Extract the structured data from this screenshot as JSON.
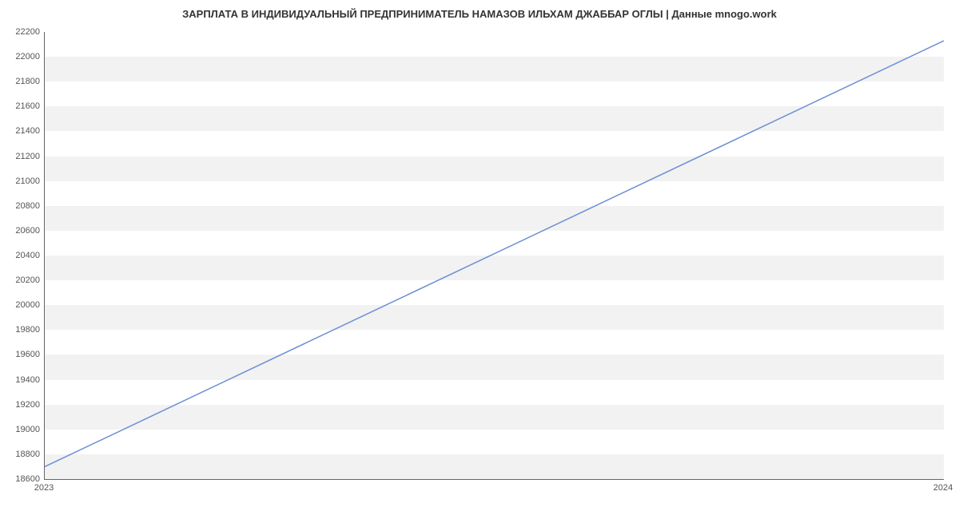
{
  "chart_data": {
    "type": "line",
    "title": "ЗАРПЛАТА В ИНДИВИДУАЛЬНЫЙ ПРЕДПРИНИМАТЕЛЬ НАМАЗОВ ИЛЬХАМ ДЖАББАР ОГЛЫ | Данные mnogo.work",
    "x": [
      2023,
      2024
    ],
    "y": [
      18700,
      22129
    ],
    "x_ticks": [
      2023,
      2024
    ],
    "y_ticks": [
      18600,
      18800,
      19000,
      19200,
      19400,
      19600,
      19800,
      20000,
      20200,
      20400,
      20600,
      20800,
      21000,
      21200,
      21400,
      21600,
      21800,
      22000,
      22200
    ],
    "xlim": [
      2023,
      2024
    ],
    "ylim": [
      18600,
      22200
    ],
    "xlabel": "",
    "ylabel": "",
    "series_color": "#6b8fd4"
  }
}
